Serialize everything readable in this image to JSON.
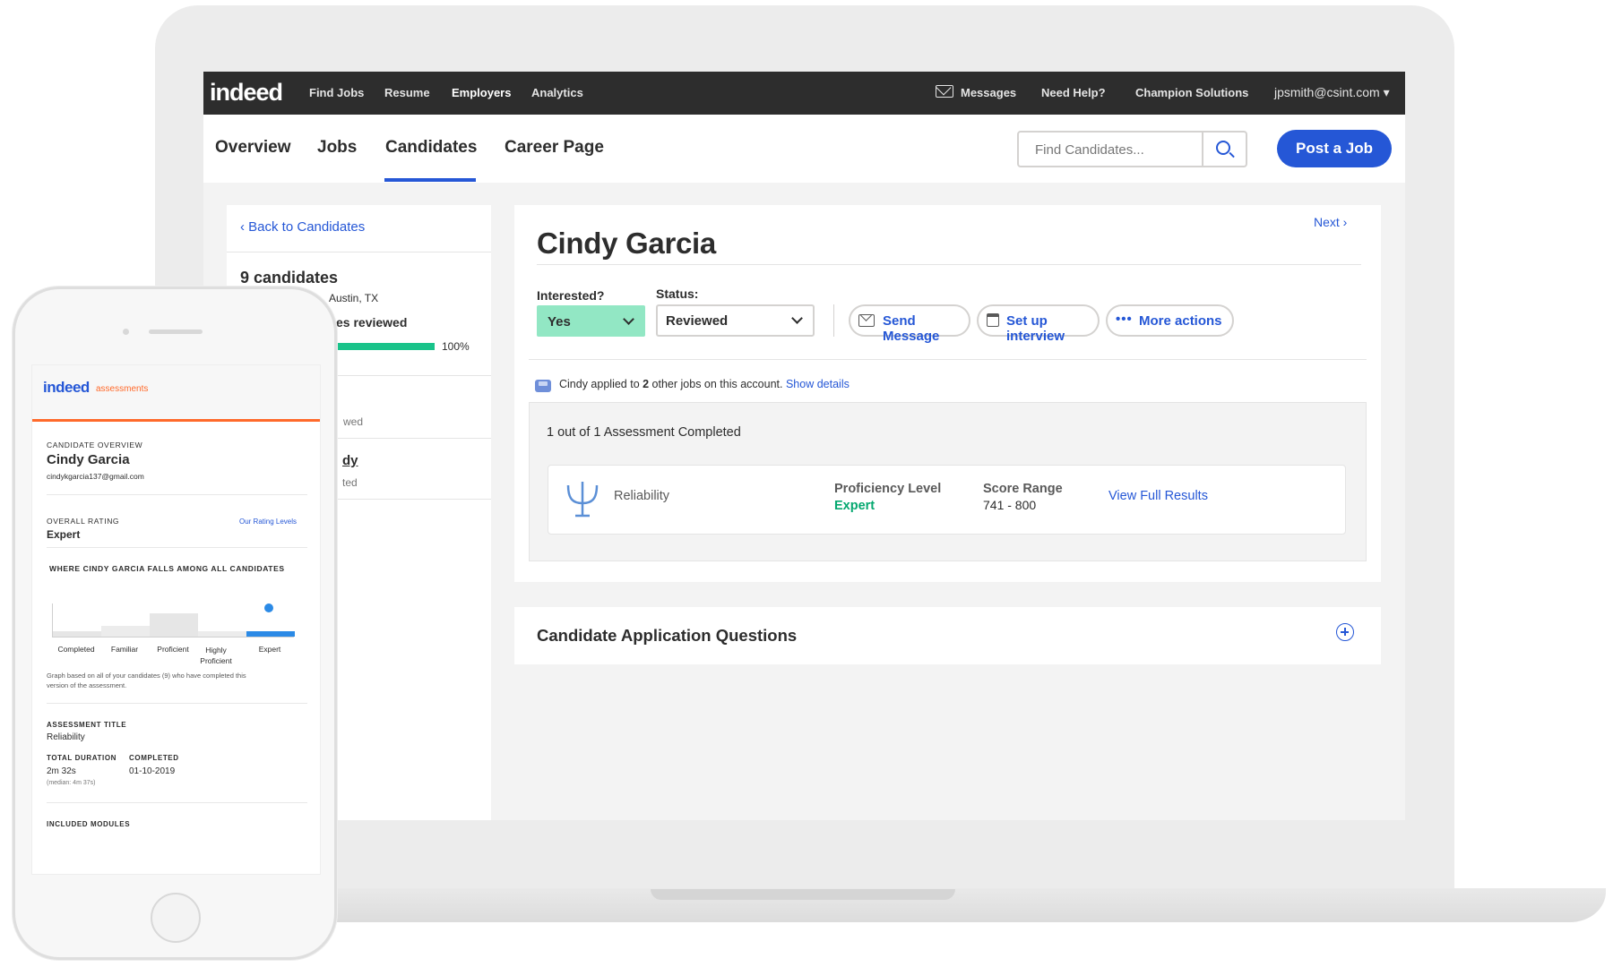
{
  "top_nav": {
    "logo": "indeed",
    "links": [
      "Find Jobs",
      "Resume",
      "Employers",
      "Analytics"
    ],
    "messages": "Messages",
    "help": "Need Help?",
    "company": "Champion Solutions",
    "user": "jpsmith@csint.com ▾"
  },
  "sub_nav": {
    "tabs": [
      "Overview",
      "Jobs",
      "Candidates",
      "Career Page"
    ],
    "active_tab": "Candidates",
    "search_placeholder": "Find Candidates...",
    "post_job": "Post a Job"
  },
  "left_panel": {
    "back": "Back to Candidates",
    "count": "9 candidates",
    "location": "Austin, TX",
    "reviewed": "es reviewed",
    "progress_pct": "100%",
    "progress_value": 1.0,
    "item1_sub": "wed",
    "item2_title": "dy",
    "item2_sub": "ted"
  },
  "candidate": {
    "next": "Next",
    "name": "Cindy Garcia",
    "interested_label": "Interested?",
    "interested_value": "Yes",
    "status_label": "Status:",
    "status_value": "Reviewed",
    "actions": [
      "Send Message",
      "Set up interview",
      "More actions"
    ],
    "applied_pre": "Cindy applied to ",
    "applied_count": "2",
    "applied_post": " other jobs on this account.",
    "show_details": "Show details"
  },
  "assessment": {
    "completed": "1 out of 1 Assessment Completed",
    "name": "Reliability",
    "proficiency_label": "Proficiency Level",
    "proficiency_value": "Expert",
    "score_label": "Score Range",
    "score_value": "741 - 800",
    "view_results": "View Full Results"
  },
  "questions": {
    "title": "Candidate Application Questions"
  },
  "phone": {
    "logo": "indeed",
    "logo_sub": "assessments",
    "overview_label": "CANDIDATE OVERVIEW",
    "name": "Cindy Garcia",
    "email": "cindykgarcia137@gmail.com",
    "overall_label": "OVERALL RATING",
    "rating_levels": "Our Rating Levels",
    "overall_value": "Expert",
    "falls_label": "WHERE CINDY GARCIA FALLS AMONG ALL CANDIDATES",
    "levels": [
      "Completed",
      "Familiar",
      "Proficient",
      "Highly Proficient",
      "Expert"
    ],
    "graph_note": "Graph based on all of your candidates (9) who have completed this version of the assessment.",
    "title_label": "ASSESSMENT TITLE",
    "title_value": "Reliability",
    "duration_label": "TOTAL DURATION",
    "duration_value": "2m 32s",
    "duration_median": "(median: 4m 37s)",
    "completed_label": "COMPLETED",
    "completed_value": "01-10-2019",
    "included_label": "INCLUDED MODULES"
  },
  "colors": {
    "brand": "#2557d6",
    "dark_nav": "#2d2d2d",
    "interested": "#92e7c4",
    "success": "#05a870",
    "accent_orange": "#ff6a2b",
    "progress": "#19c38a"
  }
}
